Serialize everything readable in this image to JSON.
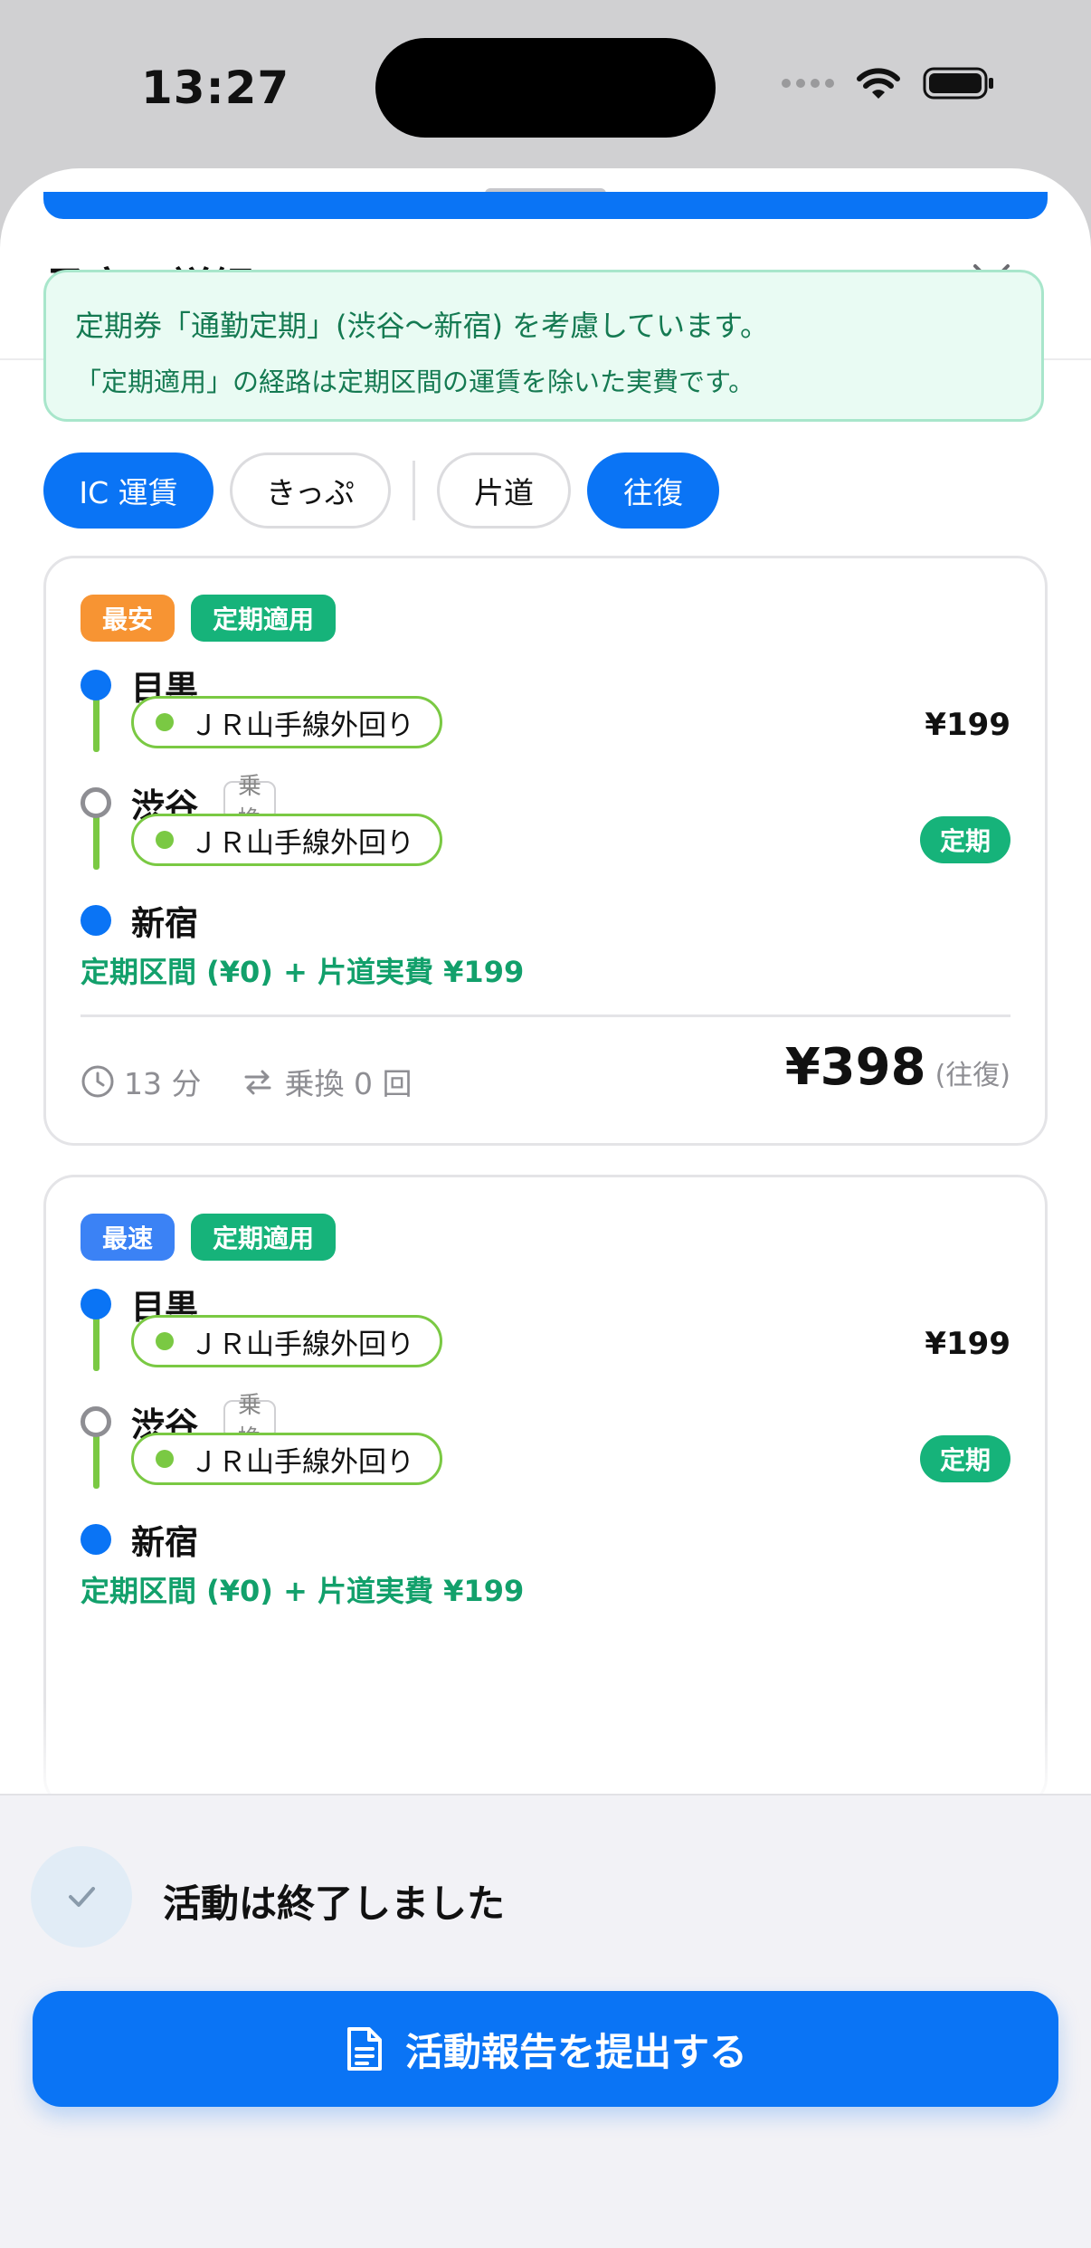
{
  "status": {
    "time": "13:27"
  },
  "sheet": {
    "title": "予定の詳細"
  },
  "notice": {
    "line1": "定期券「通勤定期」(渋谷〜新宿) を考慮しています。",
    "line2": "「定期適用」の経路は定期区間の運賃を除いた実費です。"
  },
  "filters": {
    "fare_ic": "IC 運賃",
    "fare_ticket": "きっぷ",
    "oneway": "片道",
    "roundtrip": "往復"
  },
  "routes": [
    {
      "tags": [
        "最安",
        "定期適用"
      ],
      "stops": [
        "目黒",
        "渋谷",
        "新宿"
      ],
      "transfer_label": "乗換",
      "segments": [
        {
          "line": "ＪＲ山手線外回り",
          "fare": "¥199"
        },
        {
          "line": "ＪＲ山手線外回り",
          "badge": "定期"
        }
      ],
      "summary": "定期区間 (¥0) + 片道実費 ¥199",
      "duration": "13 分",
      "transfers": "乗換 0 回",
      "total": "¥398",
      "total_suffix": "(往復)"
    },
    {
      "tags": [
        "最速",
        "定期適用"
      ],
      "stops": [
        "目黒",
        "渋谷",
        "新宿"
      ],
      "transfer_label": "乗換",
      "segments": [
        {
          "line": "ＪＲ山手線外回り",
          "fare": "¥199"
        },
        {
          "line": "ＪＲ山手線外回り",
          "badge": "定期"
        }
      ],
      "summary": "定期区間 (¥0) + 片道実費 ¥199"
    }
  ],
  "activity": {
    "status": "活動は終了しました",
    "submit_label": "活動報告を提出する"
  },
  "colors": {
    "accent": "#0a74f5",
    "teiki_green": "#16b37a",
    "line_green": "#7ac943",
    "cheapest_orange": "#f79433"
  },
  "icons": [
    "wifi-icon",
    "battery-icon",
    "close-icon",
    "clock-icon",
    "transfer-icon",
    "check-icon",
    "document-icon"
  ]
}
